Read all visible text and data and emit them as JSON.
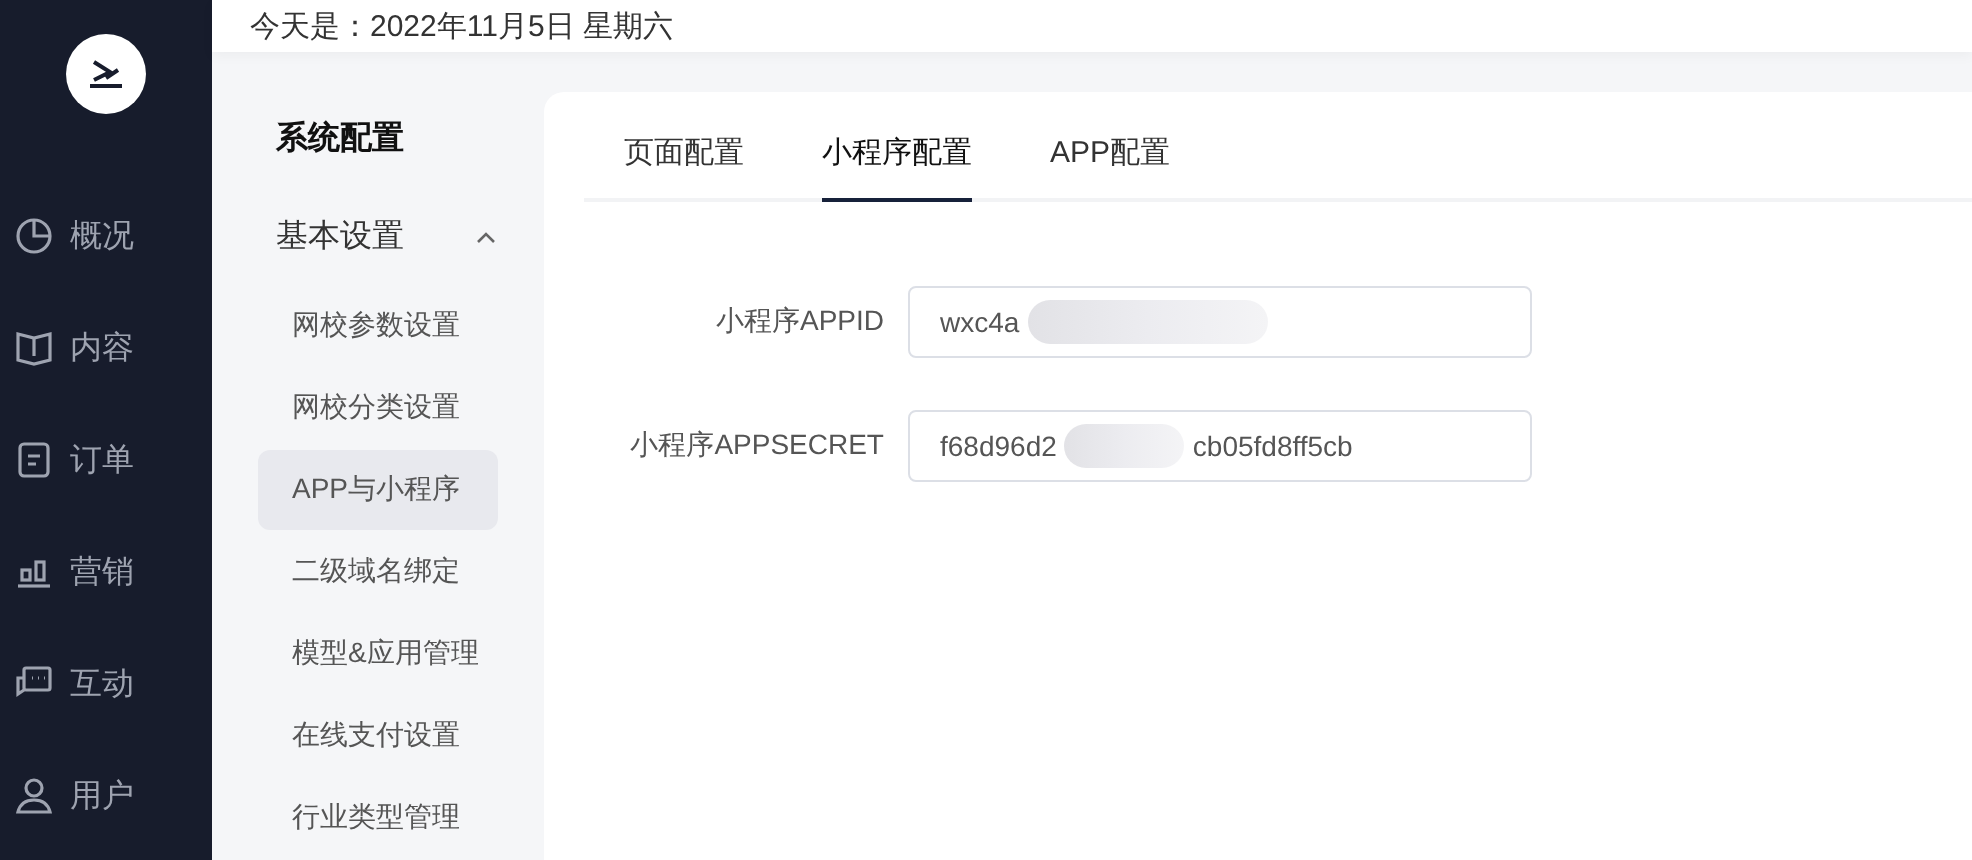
{
  "header": {
    "date_text": "今天是：2022年11月5日 星期六"
  },
  "nav": [
    {
      "label": "概况"
    },
    {
      "label": "内容"
    },
    {
      "label": "订单"
    },
    {
      "label": "营销"
    },
    {
      "label": "互动"
    },
    {
      "label": "用户"
    }
  ],
  "submenu": {
    "title": "系统配置",
    "group": {
      "label": "基本设置",
      "expanded": true,
      "items": [
        {
          "label": "网校参数设置",
          "selected": false
        },
        {
          "label": "网校分类设置",
          "selected": false
        },
        {
          "label": "APP与小程序",
          "selected": true
        },
        {
          "label": "二级域名绑定",
          "selected": false
        },
        {
          "label": "模型&应用管理",
          "selected": false
        },
        {
          "label": "在线支付设置",
          "selected": false
        },
        {
          "label": "行业类型管理",
          "selected": false
        }
      ]
    }
  },
  "tabs": [
    {
      "label": "页面配置",
      "selected": false
    },
    {
      "label": "小程序配置",
      "selected": true
    },
    {
      "label": "APP配置",
      "selected": false
    }
  ],
  "fields": [
    {
      "label": "小程序APPID",
      "value_parts": [
        "wxc4a"
      ]
    },
    {
      "label": "小程序APPSECRET",
      "value_parts": [
        "f68d96d2",
        "cb05fd8ff5cb"
      ]
    }
  ]
}
